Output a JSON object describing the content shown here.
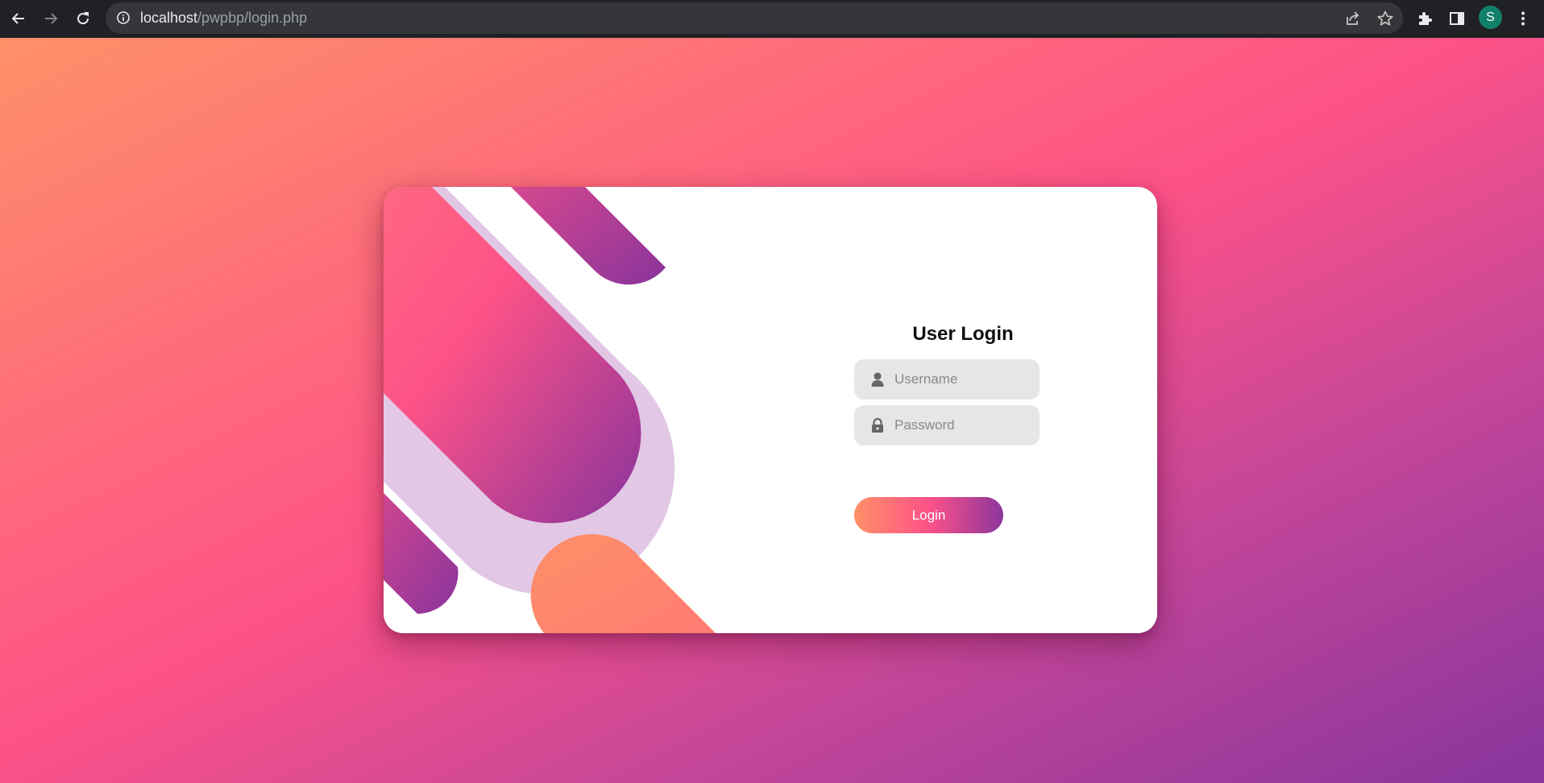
{
  "browser": {
    "url_host": "localhost",
    "url_path": "/pwpbp/login.php",
    "profile_initial": "S",
    "icons": [
      "back-arrow-icon",
      "forward-arrow-icon",
      "reload-icon",
      "info-icon",
      "share-icon",
      "star-icon",
      "extensions-icon",
      "side-panel-icon",
      "menu-icon"
    ]
  },
  "login": {
    "title": "User Login",
    "username_placeholder": "Username",
    "password_placeholder": "Password",
    "button_label": "Login"
  },
  "colors": {
    "gradient_start": "#ff9068",
    "gradient_mid": "#fd5288",
    "gradient_end": "#87359c"
  }
}
